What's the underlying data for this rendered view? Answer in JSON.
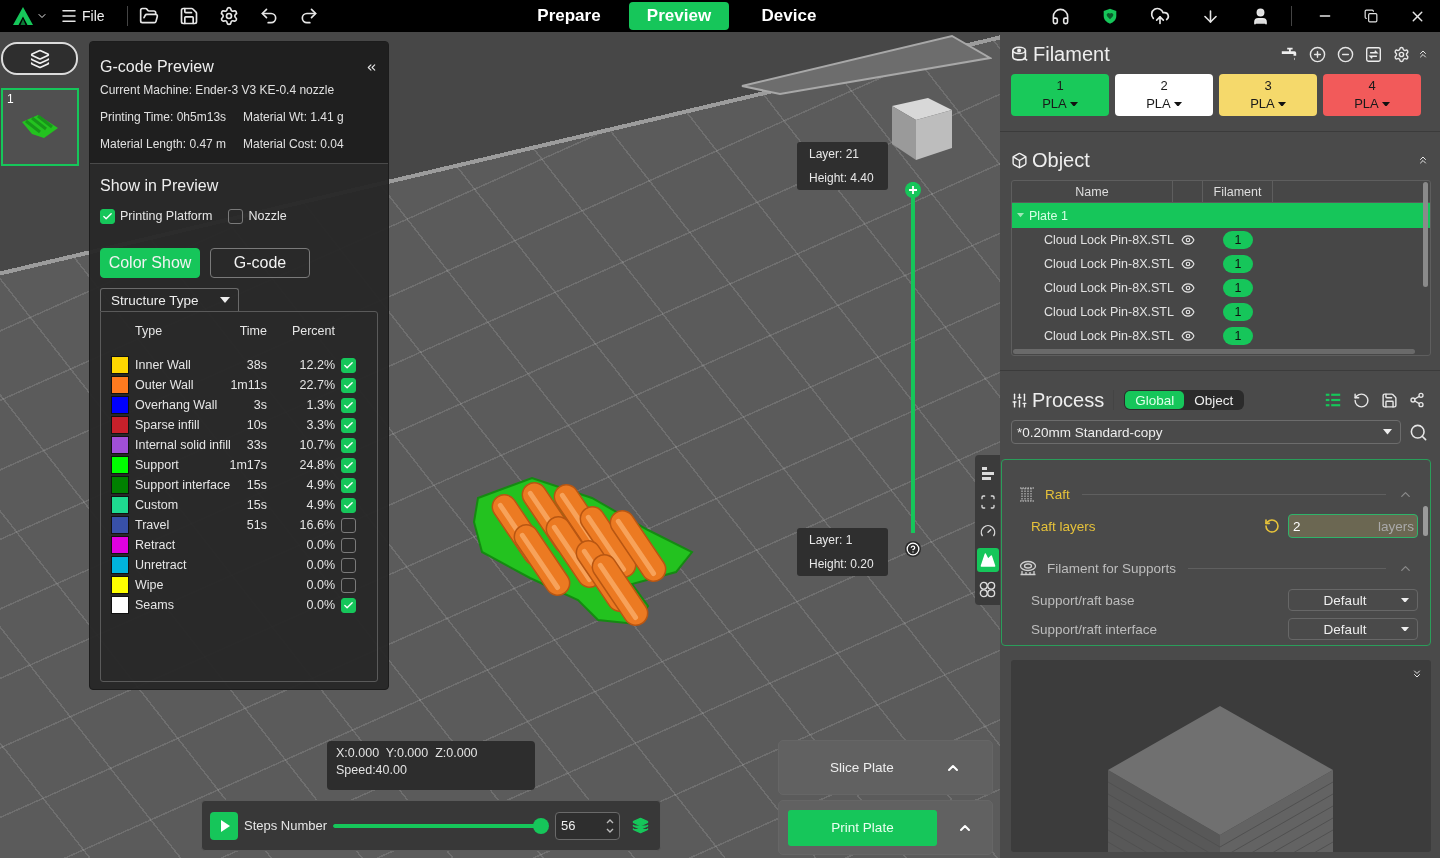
{
  "top_bar": {
    "menu_label": "File",
    "tabs": [
      {
        "label": "Prepare",
        "selected": false
      },
      {
        "label": "Preview",
        "selected": true
      },
      {
        "label": "Device",
        "selected": false
      }
    ]
  },
  "plates": [
    {
      "number": "1",
      "selected": true
    }
  ],
  "gcode_panel": {
    "title": "G-code Preview",
    "machine": "Current Machine: Ender-3 V3 KE-0.4 nozzle",
    "stats": [
      [
        "Printing Time: 0h5m13s",
        "Material Wt: 1.41 g"
      ],
      [
        "Material Length: 0.47 m",
        "Material Cost: 0.04"
      ]
    ],
    "show_title": "Show in Preview",
    "show_options": [
      {
        "label": "Printing Platform",
        "checked": true
      },
      {
        "label": "Nozzle",
        "checked": false
      }
    ],
    "view_modes": [
      {
        "label": "Color Show",
        "selected": true
      },
      {
        "label": "G-code",
        "selected": false
      }
    ],
    "view_type": "Structure Type",
    "legend_columns": [
      "Type",
      "Time",
      "Percent"
    ],
    "legend": [
      {
        "name": "Inner Wall",
        "time": "38s",
        "percent": "12.2%",
        "color": "#ffd700",
        "checked": true
      },
      {
        "name": "Outer Wall",
        "time": "1m11s",
        "percent": "22.7%",
        "color": "#ff7a1f",
        "checked": true
      },
      {
        "name": "Overhang Wall",
        "time": "3s",
        "percent": "1.3%",
        "color": "#0000ff",
        "checked": true
      },
      {
        "name": "Sparse infill",
        "time": "10s",
        "percent": "3.3%",
        "color": "#c8202a",
        "checked": true
      },
      {
        "name": "Internal solid infill",
        "time": "33s",
        "percent": "10.7%",
        "color": "#a04fd6",
        "checked": true
      },
      {
        "name": "Support",
        "time": "1m17s",
        "percent": "24.8%",
        "color": "#00ff00",
        "checked": true
      },
      {
        "name": "Support interface",
        "time": "15s",
        "percent": "4.9%",
        "color": "#008000",
        "checked": true
      },
      {
        "name": "Custom",
        "time": "15s",
        "percent": "4.9%",
        "color": "#1ed98f",
        "checked": true
      },
      {
        "name": "Travel",
        "time": "51s",
        "percent": "16.6%",
        "color": "#3850a8",
        "checked": false
      },
      {
        "name": "Retract",
        "percent": "0.0%",
        "color": "#e000e0",
        "checked": false
      },
      {
        "name": "Unretract",
        "percent": "0.0%",
        "color": "#00b4dc",
        "checked": false
      },
      {
        "name": "Wipe",
        "percent": "0.0%",
        "color": "#ffff00",
        "checked": false
      },
      {
        "name": "Seams",
        "percent": "0.0%",
        "color": "#ffffff",
        "checked": true
      }
    ]
  },
  "viewport": {
    "layer_slider": {
      "level": 1,
      "top": {
        "layer": "Layer: 21",
        "height": "Height: 4.40"
      },
      "bottom": {
        "layer": "Layer: 1",
        "height": "Height: 0.20"
      }
    },
    "side_tools": [
      {
        "kind": "legend",
        "selected": false
      },
      {
        "kind": "bounds",
        "selected": false
      },
      {
        "kind": "speed",
        "selected": false
      },
      {
        "kind": "overhang",
        "selected": true
      },
      {
        "kind": "loops",
        "selected": false
      }
    ],
    "position": {
      "coords": "X:0.000  Y:0.000  Z:0.000",
      "speed": "Speed:40.00"
    },
    "steps": {
      "label": "Steps Number",
      "level": 1,
      "value": "56"
    },
    "slice_button": {
      "label": "Slice Plate"
    },
    "print_button": {
      "label": "Print Plate"
    }
  },
  "filament": {
    "title": "Filament",
    "slots": [
      {
        "number": "1",
        "type": "PLA",
        "color": "#19c95a"
      },
      {
        "number": "2",
        "type": "PLA",
        "color": "#ffffff"
      },
      {
        "number": "3",
        "type": "PLA",
        "color": "#f5d96b"
      },
      {
        "number": "4",
        "type": "PLA",
        "color": "#f25a5a"
      }
    ]
  },
  "object": {
    "title": "Object",
    "columns": [
      "Name",
      "Filament"
    ],
    "plate": {
      "label": "Plate 1",
      "expanded": true,
      "selected": true
    },
    "items": [
      {
        "name": "Cloud Lock Pin-8X.STL",
        "visible": true,
        "filament": "1"
      },
      {
        "name": "Cloud Lock Pin-8X.STL",
        "visible": true,
        "filament": "1"
      },
      {
        "name": "Cloud Lock Pin-8X.STL",
        "visible": true,
        "filament": "1"
      },
      {
        "name": "Cloud Lock Pin-8X.STL",
        "visible": true,
        "filament": "1"
      },
      {
        "name": "Cloud Lock Pin-8X.STL",
        "visible": true,
        "filament": "1"
      }
    ]
  },
  "process": {
    "title": "Process",
    "scopes": [
      {
        "label": "Global",
        "selected": true
      },
      {
        "label": "Object",
        "selected": false
      }
    ],
    "preset": "*0.20mm Standard-copy",
    "groups": [
      {
        "kind": "raft",
        "title": "Raft",
        "modified": true,
        "expanded": true,
        "settings": [
          {
            "kind": "number",
            "label": "Raft layers",
            "value": "2",
            "unit": "layers",
            "modified": true
          }
        ]
      },
      {
        "kind": "support_filament",
        "title": "Filament for Supports",
        "modified": false,
        "expanded": true,
        "settings": [
          {
            "kind": "select",
            "label": "Support/raft base",
            "value": "Default",
            "modified": false
          },
          {
            "kind": "select",
            "label": "Support/raft interface",
            "value": "Default",
            "modified": false
          }
        ]
      }
    ]
  }
}
